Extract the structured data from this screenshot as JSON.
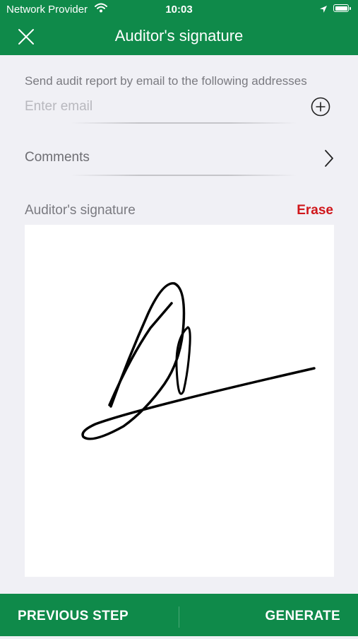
{
  "status_bar": {
    "carrier": "Network Provider",
    "time": "10:03",
    "wifi_icon": "wifi-icon",
    "location_icon": "location-arrow-icon",
    "battery_icon": "battery-icon"
  },
  "header": {
    "title": "Auditor's signature",
    "close_icon": "close-icon",
    "background_color": "#0f8a4a"
  },
  "email": {
    "label": "Send audit report by email to the following addresses",
    "placeholder": "Enter email",
    "value": "",
    "add_icon": "plus-circle-icon"
  },
  "comments": {
    "label": "Comments",
    "chevron_icon": "chevron-right-icon"
  },
  "signature": {
    "label": "Auditor's signature",
    "erase_label": "Erase",
    "erase_color": "#d0171b"
  },
  "footer": {
    "previous_label": "PREVIOUS STEP",
    "generate_label": "GENERATE"
  }
}
